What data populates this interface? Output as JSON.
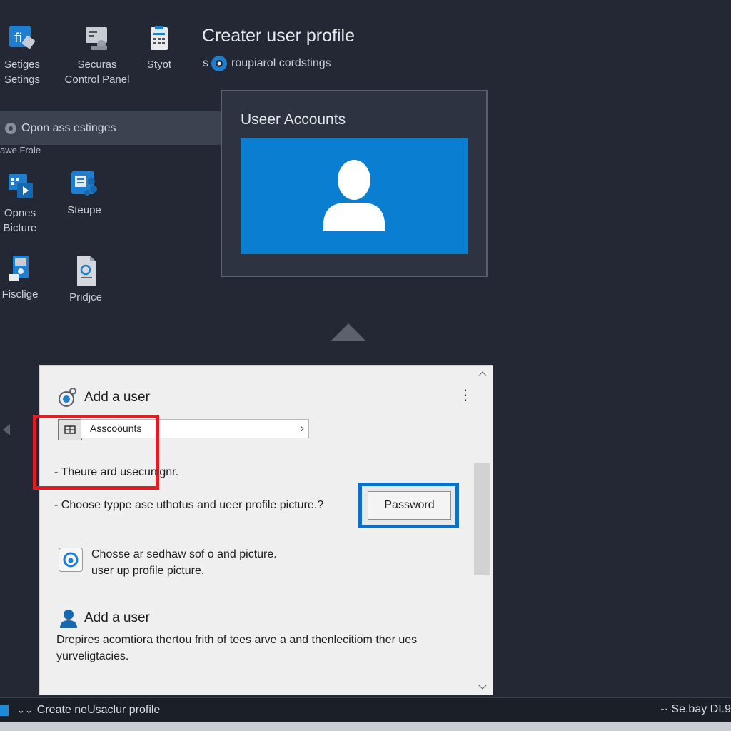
{
  "window_title": "Creater user profile",
  "search": {
    "prefix": "s",
    "text": "roupiarol cordstings"
  },
  "desktop_icons": [
    {
      "label": "Setiges\nSetings",
      "icon": "settings-icon"
    },
    {
      "label": "Securas\nControl Panel",
      "icon": "security-control-panel-icon"
    },
    {
      "label": "Styot",
      "icon": "clipboard-icon"
    },
    {
      "label": "Opnes\nBicture",
      "icon": "open-picture-icon"
    },
    {
      "label": "Steupe",
      "icon": "setup-icon"
    },
    {
      "label": "Fisclige",
      "icon": "device-icon"
    },
    {
      "label": "Pridjce",
      "icon": "document-icon"
    }
  ],
  "sidebar": {
    "open_settings": "Opon ass estinges",
    "frame_label": "awe Frale"
  },
  "user_accounts": {
    "title": "Useer Accounts"
  },
  "dialog": {
    "title": "Add a user",
    "account_field": "Asscoounts",
    "line1": "- Theure ard usecunignr.",
    "line2": "- Choose typpe ase uthotus and ueer profile picture.?",
    "password_button": "Password",
    "picture_text": "Chosse ar sedhaw sof o and picture.\nuser up profile picture.",
    "add_user_title": "Add a user",
    "description": "Drepires acomtiora thertou frith of tees arve a and thenlecitiom ther ues yurveligtacies."
  },
  "taskbar": {
    "app_label": "Create neUsaclur profile",
    "status": "-· Se.bay DI.9"
  },
  "colors": {
    "accent_blue": "#0a7fd1",
    "highlight_red": "#e01d25",
    "highlight_blue": "#0a70c8",
    "background": "#232834"
  }
}
